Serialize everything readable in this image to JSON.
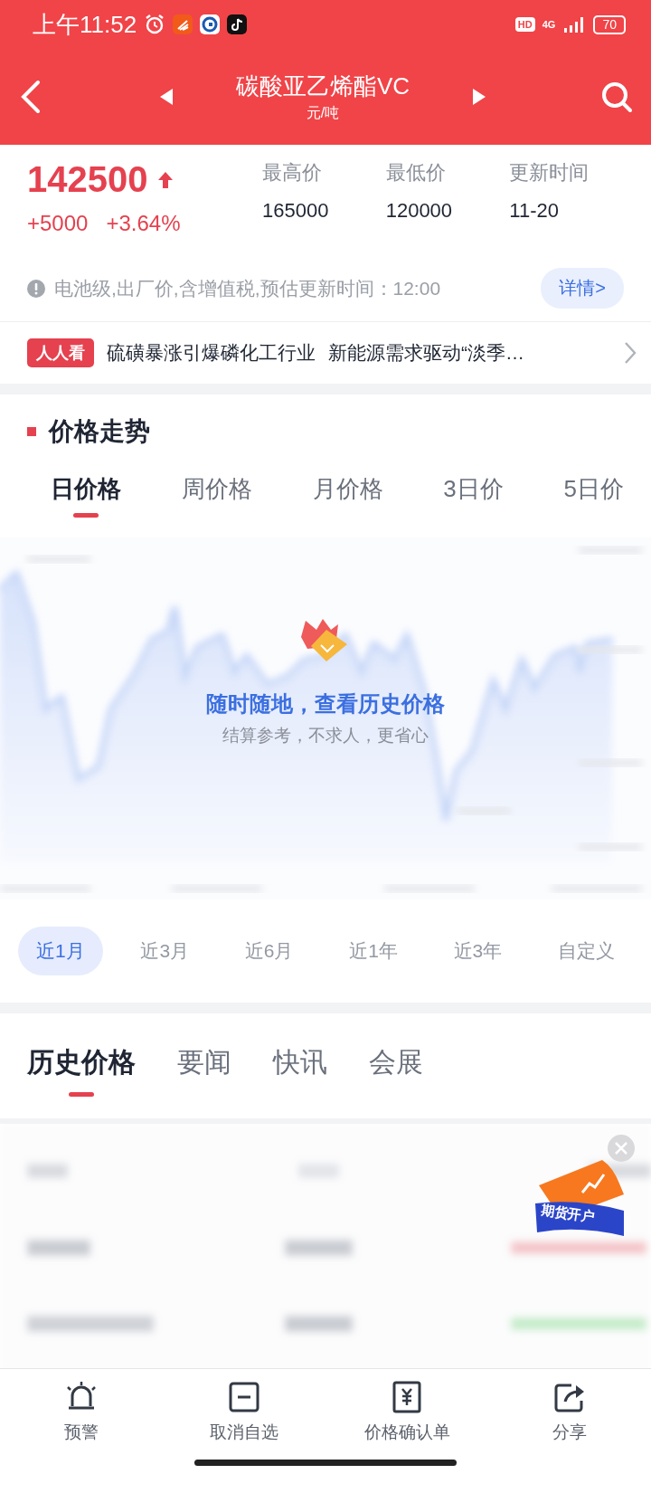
{
  "status_bar": {
    "time": "上午11:52",
    "hd": "HD",
    "network": "4G",
    "battery": "70"
  },
  "header": {
    "title": "碳酸亚乙烯酯VC",
    "unit": "元/吨"
  },
  "price": {
    "value": "142500",
    "rising": true,
    "change": "+5000",
    "percent": "+3.64%"
  },
  "stats": [
    {
      "label": "最高价",
      "value": "165000"
    },
    {
      "label": "最低价",
      "value": "120000"
    },
    {
      "label": "更新时间",
      "value": "11-20"
    }
  ],
  "note": "电池级,出厂价,含增值税,预估更新时间：12:00",
  "detail_button": "详情>",
  "news": {
    "badge": "人人看",
    "headlines": [
      "硫磺暴涨引爆磷化工行业",
      "新能源需求驱动“淡季…"
    ]
  },
  "section_title": "价格走势",
  "period_tabs": [
    {
      "label": "日价格",
      "selected": true
    },
    {
      "label": "周价格",
      "selected": false
    },
    {
      "label": "月价格",
      "selected": false
    },
    {
      "label": "3日价",
      "selected": false
    },
    {
      "label": "5日价",
      "selected": false
    }
  ],
  "chart_overlay": {
    "title": "随时随地，查看历史价格",
    "subtitle": "结算参考，不求人，更省心"
  },
  "range_tabs": [
    {
      "label": "近1月",
      "selected": true
    },
    {
      "label": "近3月",
      "selected": false
    },
    {
      "label": "近6月",
      "selected": false
    },
    {
      "label": "近1年",
      "selected": false
    },
    {
      "label": "近3年",
      "selected": false
    },
    {
      "label": "自定义",
      "selected": false
    }
  ],
  "content_tabs": [
    {
      "label": "历史价格",
      "selected": true
    },
    {
      "label": "要闻",
      "selected": false
    },
    {
      "label": "快讯",
      "selected": false
    },
    {
      "label": "会展",
      "selected": false
    }
  ],
  "promo": {
    "label": "期货开户"
  },
  "bottom_nav": [
    {
      "kind": "alarm",
      "label": "预警"
    },
    {
      "kind": "remove",
      "label": "取消自选"
    },
    {
      "kind": "receipt",
      "label": "价格确认单"
    },
    {
      "kind": "share",
      "label": "分享"
    }
  ]
}
